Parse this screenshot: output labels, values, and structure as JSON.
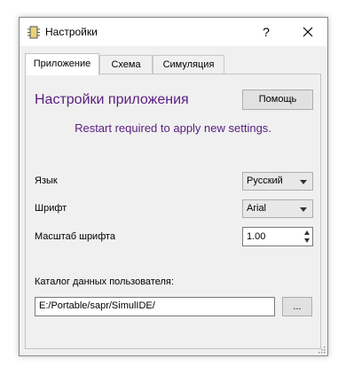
{
  "window": {
    "title": "Настройки",
    "help_glyph": "?"
  },
  "tabs": [
    {
      "label": "Приложение",
      "active": true
    },
    {
      "label": "Схема",
      "active": false
    },
    {
      "label": "Симуляция",
      "active": false
    }
  ],
  "panel": {
    "heading": "Настройки приложения",
    "help_label": "Помощь",
    "notice": "Restart required to apply new settings.",
    "language_label": "Язык",
    "language_value": "Русский",
    "font_label": "Шрифт",
    "font_value": "Arial",
    "font_scale_label": "Масштаб шрифта",
    "font_scale_value": "1.00",
    "user_data_label": "Каталог данных пользователя:",
    "user_data_path": "E:/Portable/sapr/SimulIDE/",
    "browse_label": "..."
  },
  "colors": {
    "accent": "#5a2080",
    "panel_bg": "#f0f0f0"
  },
  "icons": {
    "app": "chip-icon",
    "help": "help-icon",
    "close": "close-icon"
  }
}
